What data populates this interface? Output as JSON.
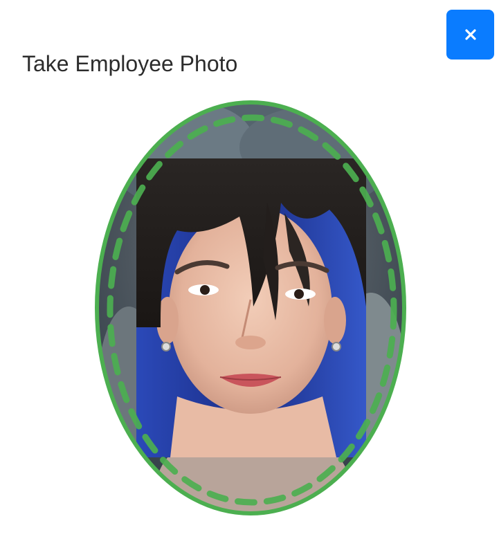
{
  "dialog": {
    "title": "Take Employee Photo",
    "close_icon": "close-icon",
    "close_color": "#0a7cff"
  },
  "camera": {
    "frame_color": "#4caf50",
    "guide_color": "#4caf50",
    "guide_style": "dashed"
  }
}
